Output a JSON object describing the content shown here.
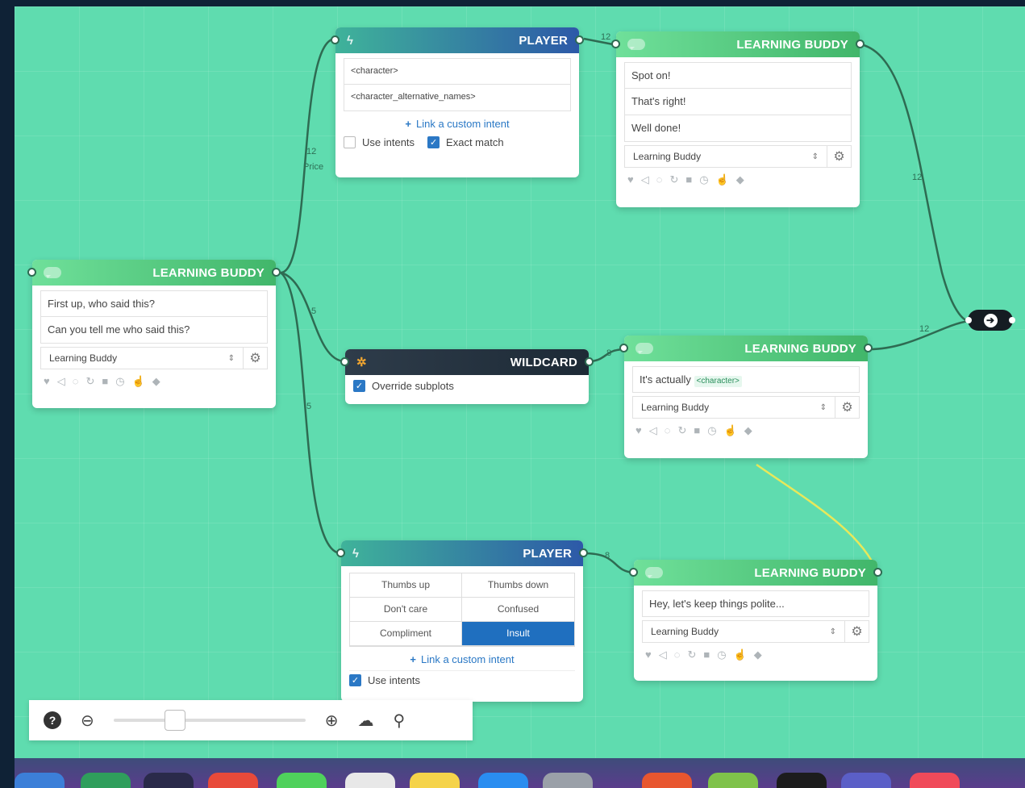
{
  "nodes": {
    "start_bot": {
      "title": "LEARNING BUDDY",
      "messages": [
        "First up, who said this?",
        "Can you tell me who said this?"
      ],
      "select": "Learning Buddy"
    },
    "player_top": {
      "title": "PLAYER",
      "intents": [
        "<character>",
        "<character_alternative_names>"
      ],
      "link_label": "Link a custom intent",
      "use_intents_label": "Use intents",
      "exact_match_label": "Exact match"
    },
    "bot_correct": {
      "title": "LEARNING BUDDY",
      "messages": [
        "Spot on!",
        "That's right!",
        "Well done!"
      ],
      "select": "Learning Buddy"
    },
    "wildcard": {
      "title": "WILDCARD",
      "override_label": "Override subplots"
    },
    "bot_actually": {
      "title": "LEARNING BUDDY",
      "message_prefix": "It's actually",
      "message_tag": "<character>",
      "select": "Learning Buddy"
    },
    "player_bottom": {
      "title": "PLAYER",
      "intent_grid": [
        "Thumbs up",
        "Thumbs down",
        "Don't care",
        "Confused",
        "Compliment",
        "Insult"
      ],
      "selected_intent": "Insult",
      "link_label": "Link a custom intent",
      "use_intents_label": "Use intents"
    },
    "bot_polite": {
      "title": "LEARNING BUDDY",
      "messages": [
        "Hey, let's keep things polite..."
      ],
      "select": "Learning Buddy"
    }
  },
  "wire_labels": [
    "12",
    "Price",
    "12",
    "5",
    "5",
    "8",
    "12",
    "12",
    "8"
  ],
  "icons": {
    "node_actions": [
      "heart-icon",
      "megaphone-icon",
      "chat-icon",
      "refresh-icon",
      "stop-icon",
      "clock-icon",
      "pointer-icon",
      "tag-icon"
    ],
    "zoom": [
      "help-icon",
      "zoom-out-icon",
      "zoom-in-icon",
      "brain-icon",
      "search-icon"
    ]
  },
  "zoom_slider": {
    "value": 0.3
  },
  "colors": {
    "canvas": "#5fdcaf",
    "bot_header": "#41b66a",
    "player_header": "#2d59a8",
    "wildcard_header": "#1d2a36",
    "selected_intent": "#1f6fbf"
  }
}
